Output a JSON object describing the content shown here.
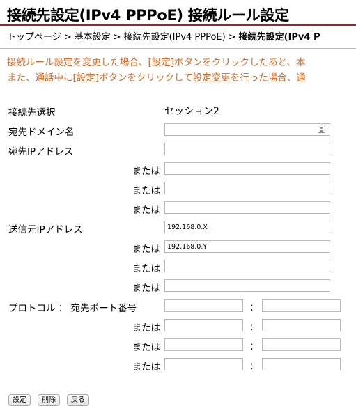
{
  "page": {
    "title": "接続先設定(IPv4 PPPoE) 接続ルール設定"
  },
  "breadcrumb": {
    "items": [
      "トップページ",
      "基本設定",
      "接続先設定(IPv4 PPPoE)",
      "接続先設定(IPv4 P"
    ],
    "separator": ">"
  },
  "notice": {
    "line1": "接続ルール設定を変更した場合、[設定]ボタンをクリックしたあと、本",
    "line2": "また、通話中に[設定]ボタンをクリックして設定変更を行った場合、通"
  },
  "form": {
    "session_label": "接続先選択",
    "session_value": "セッション2",
    "domain_label": "宛先ドメイン名",
    "domain_value": "",
    "dest_ip_label": "宛先IPアドレス",
    "or_label": "または",
    "dest_ips": [
      "",
      "",
      "",
      ""
    ],
    "src_ip_label": "送信元IPアドレス",
    "src_ips": [
      "192.168.0.X",
      "192.168.0.Y",
      "",
      ""
    ],
    "protocol_label": "プロトコル ： 宛先ポート番号",
    "colon": "：",
    "ports": [
      {
        "a": "",
        "b": ""
      },
      {
        "a": "",
        "b": ""
      },
      {
        "a": "",
        "b": ""
      },
      {
        "a": "",
        "b": ""
      }
    ]
  },
  "buttons": {
    "set": "設定",
    "delete": "削除",
    "back": "戻る"
  },
  "colors": {
    "accent": "#c8102e",
    "notice": "#e0651e"
  }
}
